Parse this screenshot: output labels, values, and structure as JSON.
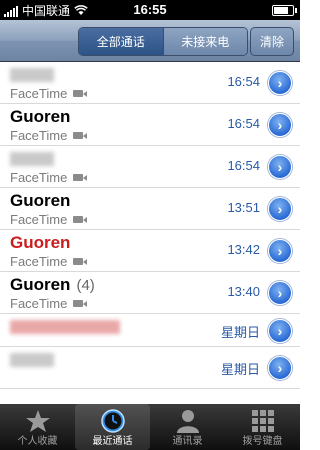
{
  "status_bar": {
    "carrier": "中国联通",
    "time": "16:55",
    "battery_level": 0.9
  },
  "nav": {
    "segments": [
      "全部通话",
      "未接来电"
    ],
    "clear_label": "清除"
  },
  "calls": [
    {
      "name": "",
      "missed": false,
      "count": "",
      "subtitle": "FaceTime",
      "time": "16:54"
    },
    {
      "name": "Guoren",
      "missed": false,
      "count": "",
      "subtitle": "FaceTime",
      "time": "16:54"
    },
    {
      "name": "",
      "missed": false,
      "count": "",
      "subtitle": "FaceTime",
      "time": "16:54"
    },
    {
      "name": "Guoren",
      "missed": false,
      "count": "",
      "subtitle": "FaceTime",
      "time": "13:51"
    },
    {
      "name": "Guoren",
      "missed": true,
      "count": "",
      "subtitle": "FaceTime",
      "time": "13:42"
    },
    {
      "name": "Guoren",
      "missed": false,
      "count": "(4)",
      "subtitle": "FaceTime",
      "time": "13:40"
    },
    {
      "name": "",
      "missed": true,
      "count": "",
      "subtitle": "",
      "time": "星期日"
    },
    {
      "name": "",
      "missed": false,
      "count": "",
      "subtitle": "",
      "time": "星期日"
    }
  ],
  "tabs": [
    {
      "label": "个人收藏",
      "icon": "star-icon"
    },
    {
      "label": "最近通话",
      "icon": "clock-icon"
    },
    {
      "label": "通讯录",
      "icon": "contacts-icon"
    },
    {
      "label": "拨号键盘",
      "icon": "keypad-icon"
    }
  ],
  "colors": {
    "accent": "#2a5aa8",
    "missed": "#cc1d1d"
  }
}
